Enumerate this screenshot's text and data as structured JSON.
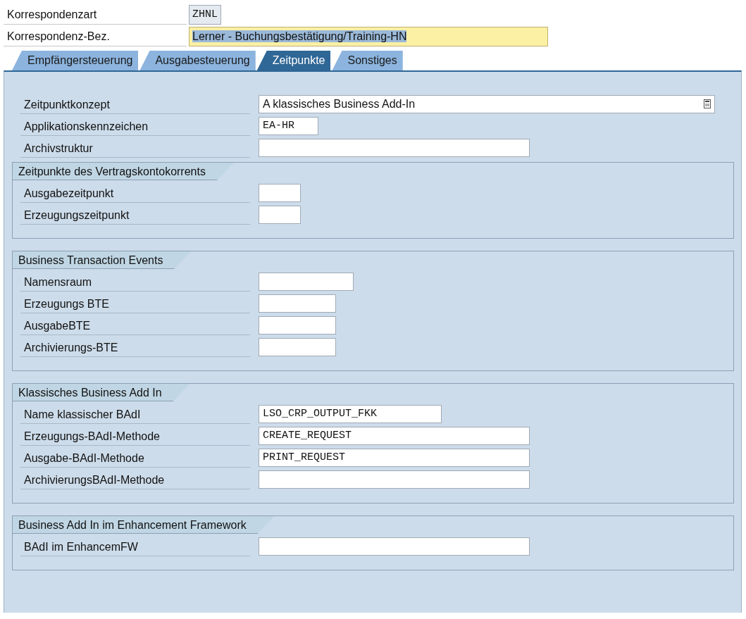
{
  "header_fields": [
    {
      "label": "Korrespondenzart",
      "value": "ZHNL",
      "kind": "readonly",
      "text_selected": false
    },
    {
      "label": "Korrespondenz-Bez.",
      "value": "Lerner - Buchungsbestätigung/Training-HN",
      "kind": "required",
      "text_selected": true
    }
  ],
  "tabs": [
    {
      "label": "Empfängersteuerung",
      "selected": false
    },
    {
      "label": "Ausgabesteuerung",
      "selected": false
    },
    {
      "label": "Zeitpunkte",
      "selected": true
    },
    {
      "label": "Sonstiges",
      "selected": false
    }
  ],
  "fields": [
    {
      "label": "Zeitpunktkonzept",
      "value": "A klassisches Business Add-In",
      "kind": "dropdown"
    },
    {
      "label": "Applikationskennzeichen",
      "value": "EA-HR",
      "kind": "text"
    },
    {
      "label": "Archivstruktur",
      "kind": "text"
    }
  ],
  "groups": [
    {
      "title": "Zeitpunkte des Vertragskontokorrents",
      "fields": [
        {
          "label": "Ausgabezeitpunkt"
        },
        {
          "label": "Erzeugungszeitpunkt"
        }
      ]
    },
    {
      "title": "Business Transaction Events",
      "fields": [
        {
          "label": "Namensraum"
        },
        {
          "label": "Erzeugungs BTE"
        },
        {
          "label": "AusgabeBTE"
        },
        {
          "label": "Archivierungs-BTE"
        }
      ]
    },
    {
      "title": "Klassisches Business Add In",
      "fields": [
        {
          "label": "Name klassischer BAdI",
          "value": "LSO_CRP_OUTPUT_FKK"
        },
        {
          "label": "Erzeugungs-BAdI-Methode",
          "value": "CREATE_REQUEST"
        },
        {
          "label": "Ausgabe-BAdI-Methode",
          "value": "PRINT_REQUEST"
        },
        {
          "label": "ArchivierungsBAdI-Methode"
        }
      ]
    },
    {
      "title": "Business Add In im Enhancement Framework",
      "fields": [
        {
          "label": "BAdI  im EnhancemFW"
        }
      ]
    }
  ]
}
